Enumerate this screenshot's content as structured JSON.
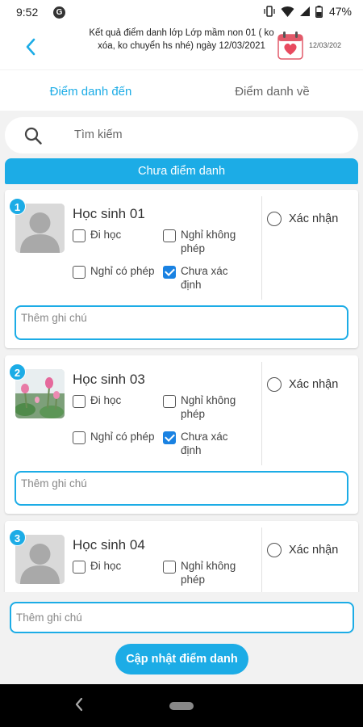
{
  "status_bar": {
    "time": "9:52",
    "battery": "47%"
  },
  "header": {
    "title": "Kết quả điểm danh lớp Lớp mầm non 01 ( ko xóa, ko chuyển hs nhé) ngày 12/03/2021",
    "date_badge": "12/03/202"
  },
  "tabs": [
    {
      "label": "Điểm danh đến",
      "active": true
    },
    {
      "label": "Điểm danh về",
      "active": false
    }
  ],
  "search": {
    "placeholder": "Tìm kiếm"
  },
  "section": {
    "banner": "Chưa điểm danh"
  },
  "options": {
    "present": "Đi học",
    "absent_unexcused": "Nghỉ không phép",
    "absent_excused": "Nghỉ có phép",
    "undetermined": "Chưa xác định",
    "confirm": "Xác nhận",
    "note_placeholder": "Thêm ghi chú"
  },
  "students": [
    {
      "num": "1",
      "name": "Học sinh 01",
      "avatar": "default-avatar",
      "status": "undetermined",
      "confirmed": false
    },
    {
      "num": "2",
      "name": "Học sinh 03",
      "avatar": "lotus-photo",
      "status": "undetermined",
      "confirmed": false
    },
    {
      "num": "3",
      "name": "Học sinh 04",
      "avatar": "default-avatar",
      "status": "undetermined",
      "confirmed": false
    }
  ],
  "footer": {
    "note_placeholder": "Thêm ghi chú",
    "update_button": "Cập nhật điểm danh"
  },
  "colors": {
    "accent": "#1cace6",
    "checkbox": "#1a82e2"
  }
}
